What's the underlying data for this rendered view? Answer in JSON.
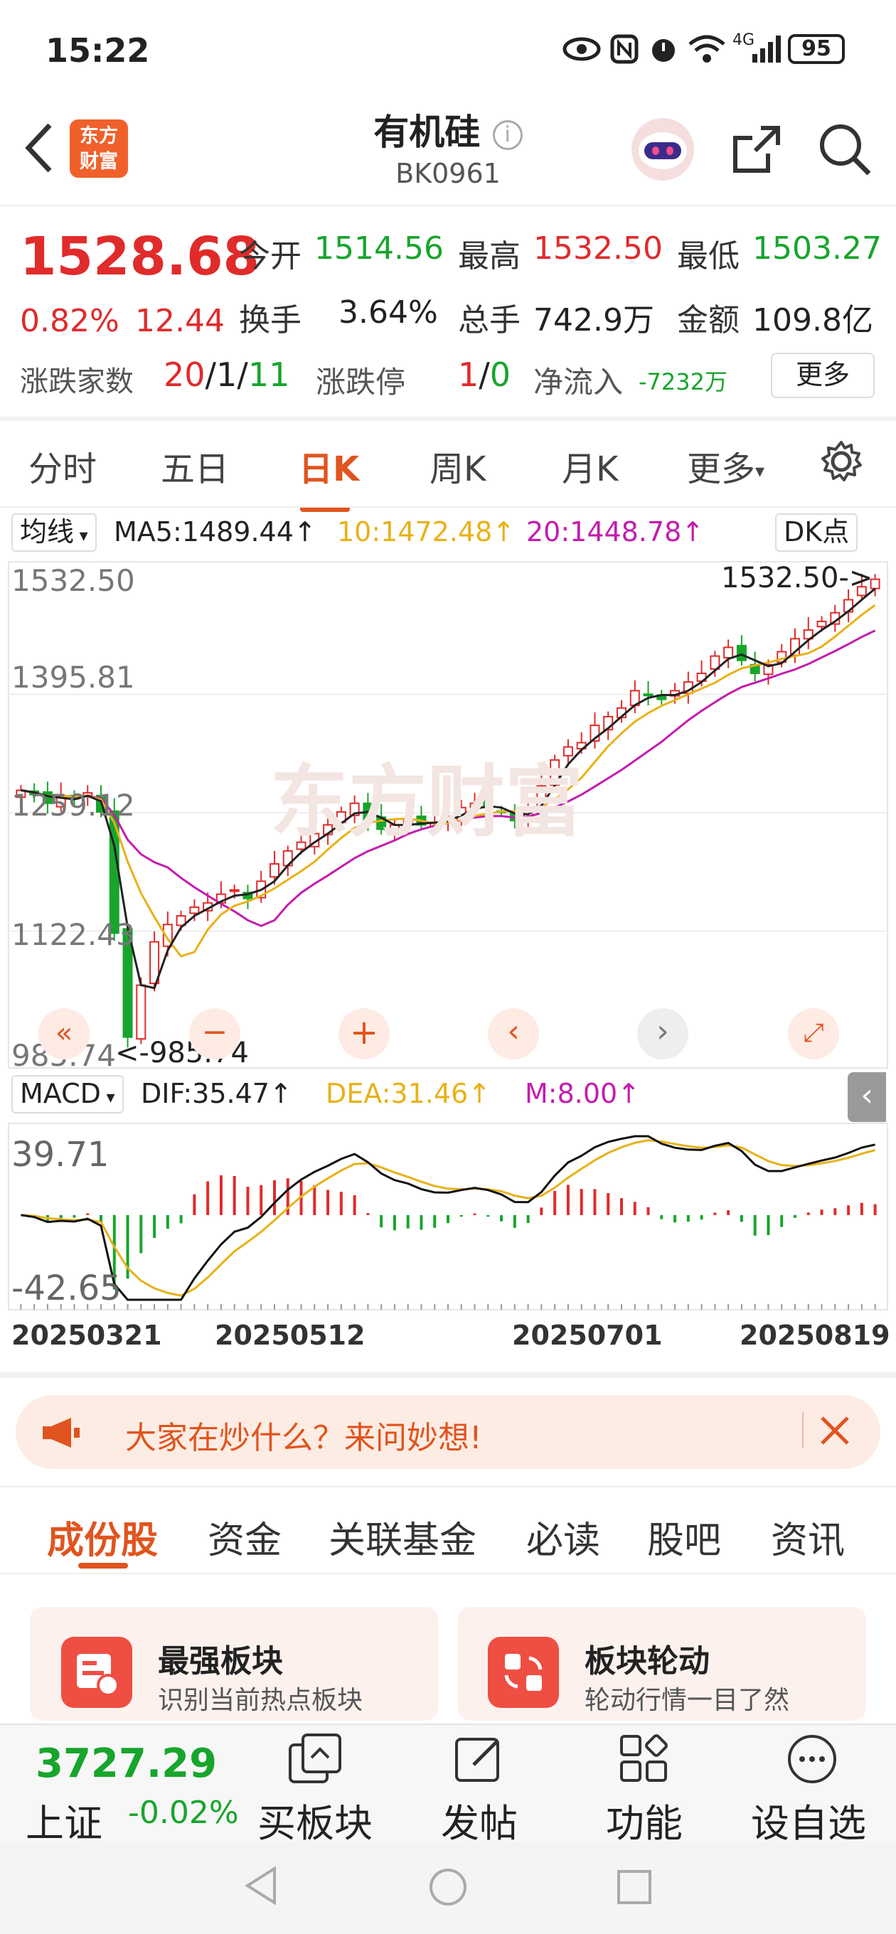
{
  "status": {
    "time": "15:22",
    "network": "4G",
    "battery": "95"
  },
  "header": {
    "title": "有机硅",
    "code": "BK0961",
    "logo_line1": "东方",
    "logo_line2": "财富"
  },
  "quote": {
    "price": "1528.68",
    "change_pct": "0.82%",
    "change": "12.44",
    "open_label": "今开",
    "open": "1514.56",
    "high_label": "最高",
    "high": "1532.50",
    "low_label": "最低",
    "low": "1503.27",
    "turnover_label": "换手",
    "turnover": "3.64%",
    "volume_label": "总手",
    "volume": "742.9万",
    "amount_label": "金额",
    "amount": "109.8亿",
    "breadth_label": "涨跌家数",
    "breadth_up": "20",
    "breadth_flat": "/1/",
    "breadth_down": "11",
    "limit_label": "涨跌停",
    "limit_up": "1",
    "limit_sep": "/",
    "limit_down": "0",
    "netflow_label": "净流入",
    "netflow": "-7232万",
    "more_button": "更多"
  },
  "period_tabs": [
    "分时",
    "五日",
    "日K",
    "周K",
    "月K",
    "更多"
  ],
  "active_period": "日K",
  "ma_bar": {
    "selector": "均线",
    "ma5": "MA5:1489.44↑",
    "ma10": "10:1472.48↑",
    "ma20": "20:1448.78↑",
    "dk_button": "DK点"
  },
  "kchart": {
    "y_labels": [
      "1532.50",
      "1395.81",
      "1259.12",
      "1122.43",
      "985.74"
    ],
    "high_marker": "1532.50->",
    "low_marker": "<-985.74",
    "watermark": "东方财富"
  },
  "macd": {
    "selector": "MACD",
    "dif": "DIF:35.47↑",
    "dea": "DEA:31.46↑",
    "m": "M:8.00↑",
    "y_top": "39.71",
    "y_bottom": "-42.65"
  },
  "dates": [
    "20250321",
    "20250512",
    "20250701",
    "20250819"
  ],
  "colors": {
    "up": "#e02b2b",
    "down": "#17a52c",
    "ma5": "#222222",
    "ma10": "#e8b118",
    "ma20": "#c41cae",
    "accent": "#e0541f"
  },
  "chart_data": {
    "type": "candlestick",
    "title": "有机硅 日K",
    "ylim": [
      985.74,
      1532.5
    ],
    "x_range": [
      "20250321",
      "20250819"
    ],
    "last_close": 1528.68,
    "period_high": 1532.5,
    "period_low": 985.74,
    "series": [
      {
        "name": "MA5",
        "last": 1489.44
      },
      {
        "name": "MA10",
        "last": 1472.48
      },
      {
        "name": "MA20",
        "last": 1448.78
      }
    ],
    "close_path": [
      1285,
      1280,
      1270,
      1279,
      1275,
      1282,
      1260,
      1120,
      1000,
      1060,
      1110,
      1130,
      1140,
      1150,
      1155,
      1165,
      1170,
      1160,
      1180,
      1200,
      1215,
      1225,
      1235,
      1245,
      1260,
      1270,
      1250,
      1240,
      1245,
      1250,
      1245,
      1248,
      1255,
      1265,
      1270,
      1265,
      1260,
      1250,
      1262,
      1290,
      1320,
      1335,
      1340,
      1360,
      1370,
      1380,
      1400,
      1395,
      1390,
      1400,
      1410,
      1420,
      1440,
      1450,
      1435,
      1420,
      1430,
      1445,
      1460,
      1470,
      1480,
      1490,
      1505,
      1520,
      1528.68
    ],
    "macd": {
      "dif": 35.47,
      "dea": 31.46,
      "m": 8.0,
      "ylim": [
        -42.65,
        39.71
      ]
    }
  },
  "ad_banner": {
    "text": "大家在炒什么？来问妙想!"
  },
  "section_tabs": [
    "成份股",
    "资金",
    "关联基金",
    "必读",
    "股吧",
    "资讯"
  ],
  "cards": [
    {
      "title": "最强板块",
      "subtitle": "识别当前热点板块"
    },
    {
      "title": "板块轮动",
      "subtitle": "轮动行情一目了然"
    }
  ],
  "bottom_bar": {
    "index_value": "3727.29",
    "index_name": "上证",
    "index_change": "-0.02%",
    "items": [
      "买板块",
      "发帖",
      "功能",
      "设自选"
    ]
  }
}
